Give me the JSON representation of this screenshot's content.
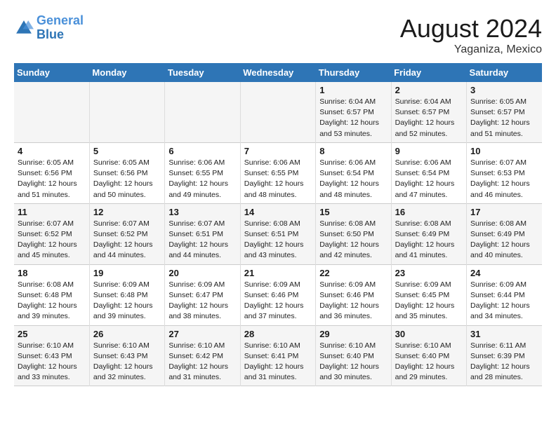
{
  "header": {
    "logo_line1": "General",
    "logo_line2": "Blue",
    "month": "August 2024",
    "location": "Yaganiza, Mexico"
  },
  "days_of_week": [
    "Sunday",
    "Monday",
    "Tuesday",
    "Wednesday",
    "Thursday",
    "Friday",
    "Saturday"
  ],
  "weeks": [
    [
      {
        "day": "",
        "info": ""
      },
      {
        "day": "",
        "info": ""
      },
      {
        "day": "",
        "info": ""
      },
      {
        "day": "",
        "info": ""
      },
      {
        "day": "1",
        "info": "Sunrise: 6:04 AM\nSunset: 6:57 PM\nDaylight: 12 hours\nand 53 minutes."
      },
      {
        "day": "2",
        "info": "Sunrise: 6:04 AM\nSunset: 6:57 PM\nDaylight: 12 hours\nand 52 minutes."
      },
      {
        "day": "3",
        "info": "Sunrise: 6:05 AM\nSunset: 6:57 PM\nDaylight: 12 hours\nand 51 minutes."
      }
    ],
    [
      {
        "day": "4",
        "info": "Sunrise: 6:05 AM\nSunset: 6:56 PM\nDaylight: 12 hours\nand 51 minutes."
      },
      {
        "day": "5",
        "info": "Sunrise: 6:05 AM\nSunset: 6:56 PM\nDaylight: 12 hours\nand 50 minutes."
      },
      {
        "day": "6",
        "info": "Sunrise: 6:06 AM\nSunset: 6:55 PM\nDaylight: 12 hours\nand 49 minutes."
      },
      {
        "day": "7",
        "info": "Sunrise: 6:06 AM\nSunset: 6:55 PM\nDaylight: 12 hours\nand 48 minutes."
      },
      {
        "day": "8",
        "info": "Sunrise: 6:06 AM\nSunset: 6:54 PM\nDaylight: 12 hours\nand 48 minutes."
      },
      {
        "day": "9",
        "info": "Sunrise: 6:06 AM\nSunset: 6:54 PM\nDaylight: 12 hours\nand 47 minutes."
      },
      {
        "day": "10",
        "info": "Sunrise: 6:07 AM\nSunset: 6:53 PM\nDaylight: 12 hours\nand 46 minutes."
      }
    ],
    [
      {
        "day": "11",
        "info": "Sunrise: 6:07 AM\nSunset: 6:52 PM\nDaylight: 12 hours\nand 45 minutes."
      },
      {
        "day": "12",
        "info": "Sunrise: 6:07 AM\nSunset: 6:52 PM\nDaylight: 12 hours\nand 44 minutes."
      },
      {
        "day": "13",
        "info": "Sunrise: 6:07 AM\nSunset: 6:51 PM\nDaylight: 12 hours\nand 44 minutes."
      },
      {
        "day": "14",
        "info": "Sunrise: 6:08 AM\nSunset: 6:51 PM\nDaylight: 12 hours\nand 43 minutes."
      },
      {
        "day": "15",
        "info": "Sunrise: 6:08 AM\nSunset: 6:50 PM\nDaylight: 12 hours\nand 42 minutes."
      },
      {
        "day": "16",
        "info": "Sunrise: 6:08 AM\nSunset: 6:49 PM\nDaylight: 12 hours\nand 41 minutes."
      },
      {
        "day": "17",
        "info": "Sunrise: 6:08 AM\nSunset: 6:49 PM\nDaylight: 12 hours\nand 40 minutes."
      }
    ],
    [
      {
        "day": "18",
        "info": "Sunrise: 6:08 AM\nSunset: 6:48 PM\nDaylight: 12 hours\nand 39 minutes."
      },
      {
        "day": "19",
        "info": "Sunrise: 6:09 AM\nSunset: 6:48 PM\nDaylight: 12 hours\nand 39 minutes."
      },
      {
        "day": "20",
        "info": "Sunrise: 6:09 AM\nSunset: 6:47 PM\nDaylight: 12 hours\nand 38 minutes."
      },
      {
        "day": "21",
        "info": "Sunrise: 6:09 AM\nSunset: 6:46 PM\nDaylight: 12 hours\nand 37 minutes."
      },
      {
        "day": "22",
        "info": "Sunrise: 6:09 AM\nSunset: 6:46 PM\nDaylight: 12 hours\nand 36 minutes."
      },
      {
        "day": "23",
        "info": "Sunrise: 6:09 AM\nSunset: 6:45 PM\nDaylight: 12 hours\nand 35 minutes."
      },
      {
        "day": "24",
        "info": "Sunrise: 6:09 AM\nSunset: 6:44 PM\nDaylight: 12 hours\nand 34 minutes."
      }
    ],
    [
      {
        "day": "25",
        "info": "Sunrise: 6:10 AM\nSunset: 6:43 PM\nDaylight: 12 hours\nand 33 minutes."
      },
      {
        "day": "26",
        "info": "Sunrise: 6:10 AM\nSunset: 6:43 PM\nDaylight: 12 hours\nand 32 minutes."
      },
      {
        "day": "27",
        "info": "Sunrise: 6:10 AM\nSunset: 6:42 PM\nDaylight: 12 hours\nand 31 minutes."
      },
      {
        "day": "28",
        "info": "Sunrise: 6:10 AM\nSunset: 6:41 PM\nDaylight: 12 hours\nand 31 minutes."
      },
      {
        "day": "29",
        "info": "Sunrise: 6:10 AM\nSunset: 6:40 PM\nDaylight: 12 hours\nand 30 minutes."
      },
      {
        "day": "30",
        "info": "Sunrise: 6:10 AM\nSunset: 6:40 PM\nDaylight: 12 hours\nand 29 minutes."
      },
      {
        "day": "31",
        "info": "Sunrise: 6:11 AM\nSunset: 6:39 PM\nDaylight: 12 hours\nand 28 minutes."
      }
    ]
  ]
}
